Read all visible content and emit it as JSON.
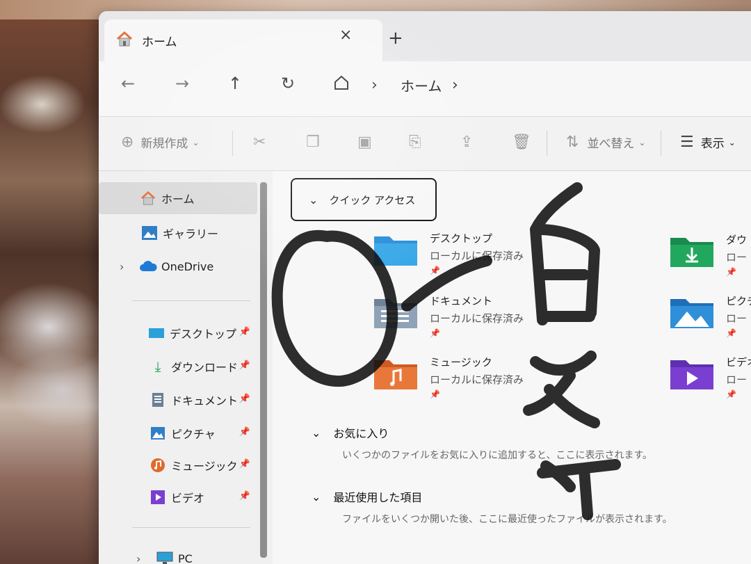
{
  "window": {
    "tab_title": "ホーム",
    "tab_close": "×",
    "tab_new": "+"
  },
  "address": {
    "back": "←",
    "forward": "→",
    "up": "↑",
    "refresh": "↻",
    "sep": "›",
    "location": "ホーム"
  },
  "toolbar": {
    "new_label": "新規作成",
    "sort_label": "並べ替え",
    "view_label": "表示"
  },
  "sidebar": {
    "items": [
      {
        "label": "ホーム"
      },
      {
        "label": "ギャラリー"
      },
      {
        "label": "OneDrive"
      },
      {
        "label": "デスクトップ"
      },
      {
        "label": "ダウンロード"
      },
      {
        "label": "ドキュメント"
      },
      {
        "label": "ピクチャ"
      },
      {
        "label": "ミュージック"
      },
      {
        "label": "ビデオ"
      },
      {
        "label": "PC"
      }
    ]
  },
  "quick_access": {
    "header": "クイック アクセス",
    "tiles": [
      {
        "name": "デスクトップ",
        "sub": "ローカルに保存済み"
      },
      {
        "name": "ドキュメント",
        "sub": "ローカルに保存済み"
      },
      {
        "name": "ミュージック",
        "sub": "ローカルに保存済み"
      },
      {
        "name": "ダウ",
        "sub": "ロー"
      },
      {
        "name": "ピクチ",
        "sub": "ロー"
      },
      {
        "name": "ビデオ",
        "sub": "ロー"
      }
    ]
  },
  "favorites": {
    "header": "お気に入り",
    "message": "いくつかのファイルをお気に入りに追加すると、ここに表示されます。"
  },
  "recent": {
    "header": "最近使用した項目",
    "message": "ファイルをいくつか開いた後、ここに最近使ったファイルが表示されます。"
  },
  "colors": {
    "accent": "#0067c0",
    "folder_blue": "#2a8fd8",
    "folder_green": "#1f9e5a",
    "music_orange": "#e06a2c",
    "video_purple": "#7a3fd0",
    "home_orange": "#e8743b"
  },
  "icons": {
    "home": "home-icon",
    "gallery": "gallery-icon",
    "onedrive": "cloud-icon",
    "desktop": "desktop-icon",
    "download": "download-icon",
    "documents": "document-icon",
    "pictures": "picture-icon",
    "music": "music-icon",
    "video": "video-icon",
    "pc": "monitor-icon"
  }
}
